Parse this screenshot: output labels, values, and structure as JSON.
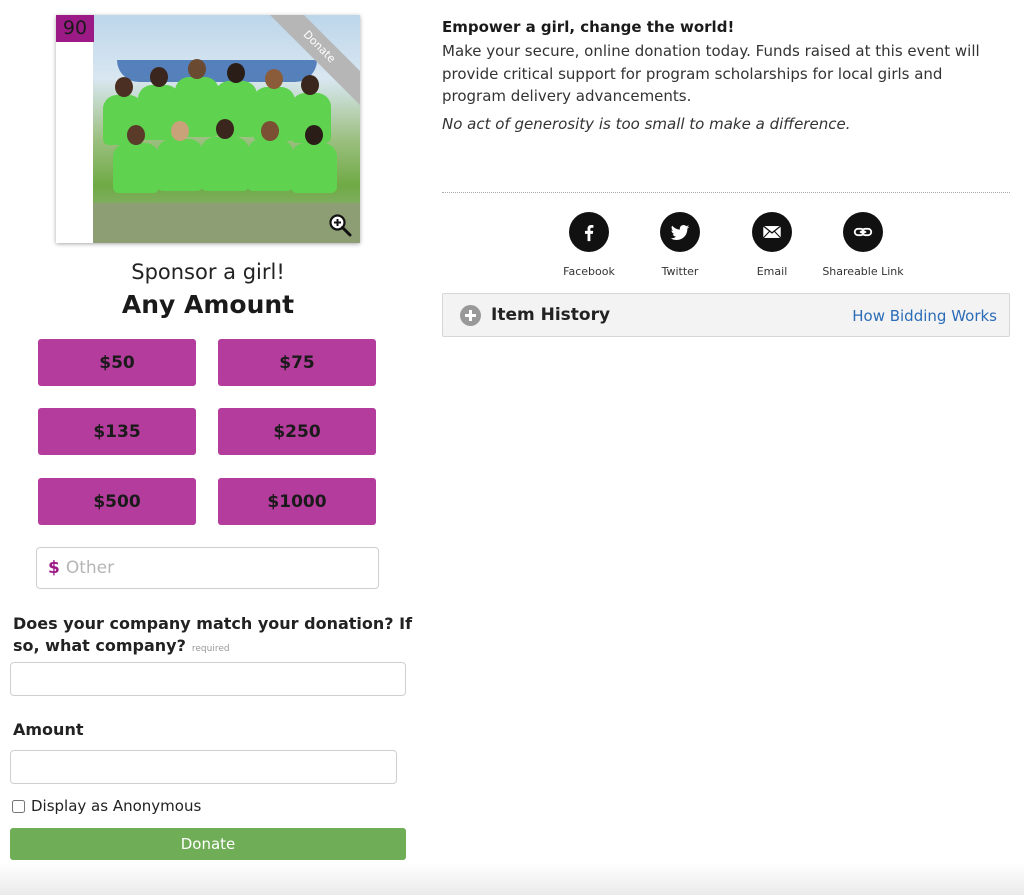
{
  "item": {
    "number": "90",
    "ribbon_label": "Donate",
    "title": "Sponsor a girl!",
    "amount_heading": "Any Amount"
  },
  "amounts": {
    "a50": "$50",
    "a75": "$75",
    "a135": "$135",
    "a250": "$250",
    "a500": "$500",
    "a1000": "$1000"
  },
  "other": {
    "currency_symbol": "$",
    "placeholder": "Other",
    "value": ""
  },
  "match": {
    "question": "Does your company match your donation? If so, what company?",
    "required_tag": "required",
    "value": ""
  },
  "amount_field": {
    "label": "Amount",
    "value": ""
  },
  "anonymous": {
    "label": "Display as Anonymous",
    "checked": false
  },
  "donate_button": "Donate",
  "description": {
    "headline": "Empower a girl, change the world!",
    "body": "Make your secure, online donation today. Funds raised at this event will provide critical support for program scholarships for local girls and program delivery advancements.",
    "tagline": "No act of generosity is too small to make a difference."
  },
  "share": {
    "facebook": "Facebook",
    "twitter": "Twitter",
    "email": "Email",
    "link": "Shareable Link"
  },
  "history": {
    "title": "Item History",
    "how_link": "How Bidding Works"
  },
  "colors": {
    "accent_magenta": "#b43c9c",
    "donate_green": "#6fae56",
    "link_blue": "#2b6cb8",
    "item_number_bg": "#9b1a86"
  }
}
